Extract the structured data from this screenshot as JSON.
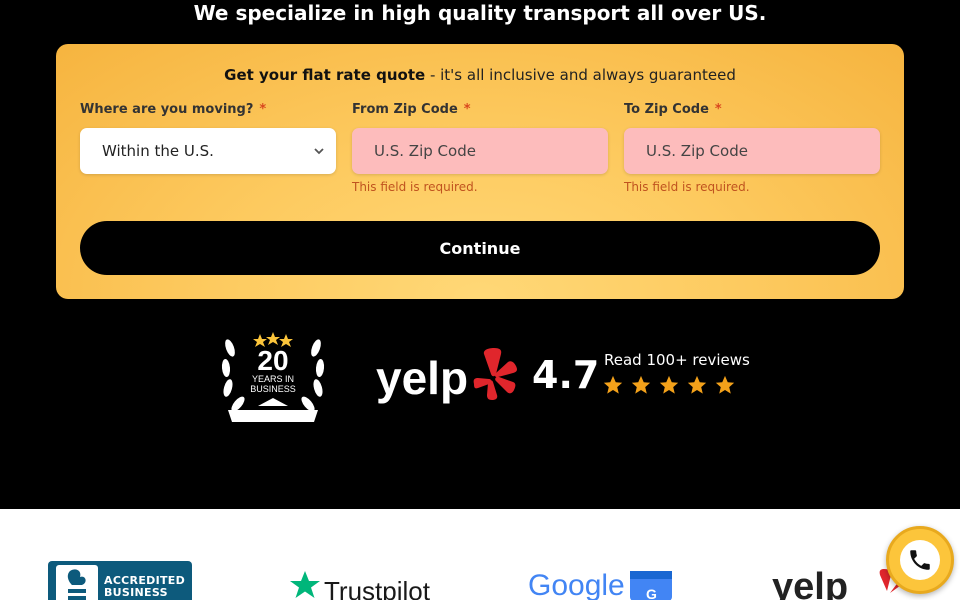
{
  "headline": "We specialize in high quality transport all over US.",
  "quote": {
    "title_bold": "Get your flat rate quote",
    "title_rest": " - it's all inclusive and always guaranteed",
    "fields": {
      "moving": {
        "label": "Where are you moving?",
        "required_mark": "*",
        "value": "Within the U.S."
      },
      "from_zip": {
        "label": "From Zip Code",
        "required_mark": "*",
        "placeholder": "U.S. Zip Code",
        "error": "This field is required."
      },
      "to_zip": {
        "label": "To Zip Code",
        "required_mark": "*",
        "placeholder": "U.S. Zip Code",
        "error": "This field is required."
      }
    },
    "continue_label": "Continue"
  },
  "badge": {
    "number": "20",
    "line1": "YEARS IN",
    "line2": "BUSINESS",
    "stars": 3
  },
  "yelp": {
    "logo_text": "yelp",
    "rating": "4.7",
    "reviews_label": "Read 100+ reviews",
    "stars": 5
  },
  "partners": {
    "bbb": {
      "line1": "ACCREDITED",
      "line2": "BUSINESS"
    },
    "trustpilot": {
      "name": "Trustpilot"
    },
    "google": {
      "name": "Google"
    },
    "yelp": {
      "name": "yelp"
    }
  },
  "colors": {
    "accent_yellow": "#fcc53b",
    "yelp_red": "#e0262c",
    "star_orange": "#f3a11a",
    "error_bg": "#fdbcbc"
  },
  "icons": {
    "call": "phone-icon",
    "select": "chevron-down-icon"
  }
}
